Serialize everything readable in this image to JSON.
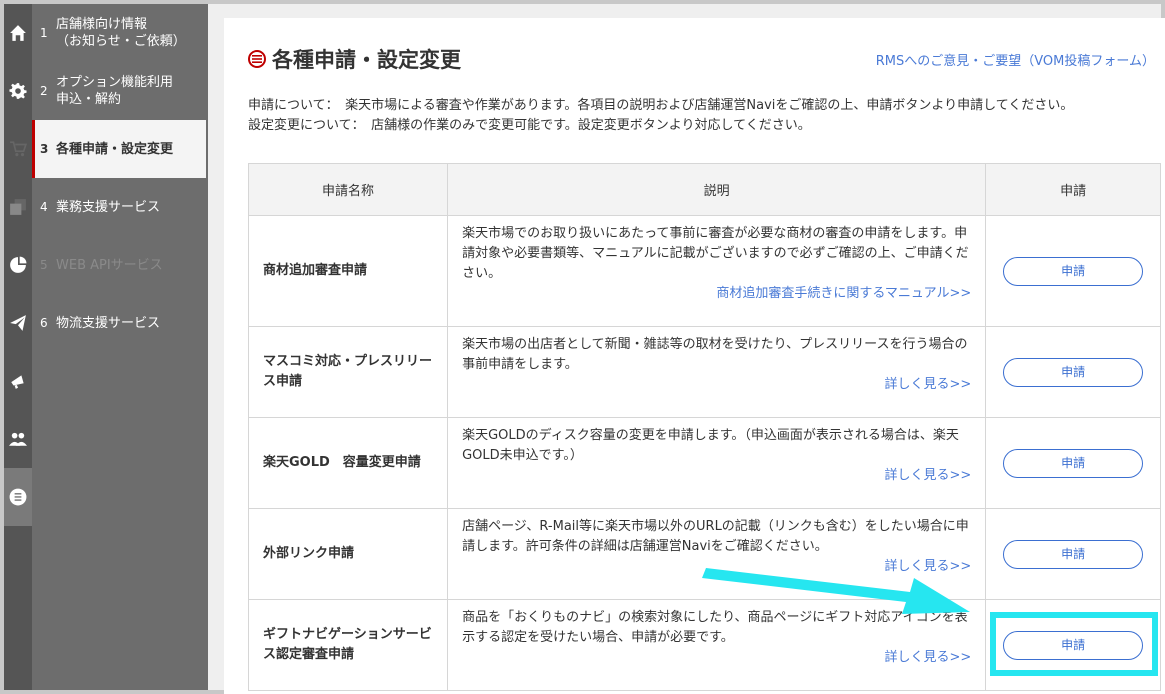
{
  "sidebar": {
    "menu": [
      {
        "num": "1",
        "label": "店舗様向け情報\n（お知らせ・ご依頼）"
      },
      {
        "num": "2",
        "label": "オプション機能利用\n申込・解約"
      },
      {
        "num": "3",
        "label": "各種申請・設定変更"
      },
      {
        "num": "4",
        "label": "業務支援サービス"
      },
      {
        "num": "5",
        "label": "WEB APIサービス"
      },
      {
        "num": "6",
        "label": "物流支援サービス"
      }
    ],
    "icons": [
      "home-icon",
      "gear-icon",
      "cart-icon",
      "copy-icon",
      "pie-chart-icon",
      "paper-plane-icon",
      "megaphone-icon",
      "users-icon",
      "list-icon"
    ]
  },
  "header": {
    "title": "各種申請・設定変更",
    "feedback_link": "RMSへのご意見・ご要望（VOM投稿フォーム）"
  },
  "intro": {
    "line1": "申請について：　楽天市場による審査や作業があります。各項目の説明および店舗運営Naviをご確認の上、申請ボタンより申請してください。",
    "line2": "設定変更について：　店舗様の作業のみで変更可能です。設定変更ボタンより対応してください。"
  },
  "table": {
    "headers": {
      "name": "申請名称",
      "description": "説明",
      "action": "申請"
    },
    "rows": [
      {
        "name": "商材追加審査申請",
        "description": "楽天市場でのお取り扱いにあたって事前に審査が必要な商材の審査の申請をします。申請対象や必要書類等、マニュアルに記載がございますので必ずご確認の上、ご申請ください。",
        "link": "商材追加審査手続きに関するマニュアル>>",
        "button": "申請"
      },
      {
        "name": "マスコミ対応・プレスリリース申請",
        "description": "楽天市場の出店者として新聞・雑誌等の取材を受けたり、プレスリリースを行う場合の事前申請をします。",
        "link": "詳しく見る>>",
        "button": "申請"
      },
      {
        "name": "楽天GOLD　容量変更申請",
        "description": "楽天GOLDのディスク容量の変更を申請します。（申込画面が表示される場合は、楽天GOLD未申込です。）",
        "link": "詳しく見る>>",
        "button": "申請"
      },
      {
        "name": "外部リンク申請",
        "description": "店舗ページ、R-Mail等に楽天市場以外のURLの記載（リンクも含む）をしたい場合に申請します。許可条件の詳細は店舗運営Naviをご確認ください。",
        "link": "詳しく見る>>",
        "button": "申請"
      },
      {
        "name": "ギフトナビゲーションサービス認定審査申請",
        "description": "商品を「おくりものナビ」の検索対象にしたり、商品ページにギフト対応アイコンを表示する認定を受けたい場合、申請が必要です。",
        "link": "詳しく見る>>",
        "button": "申請"
      }
    ]
  },
  "colors": {
    "accent": "#bf0000",
    "link": "#4a7ad6",
    "button": "#3b6fd1",
    "highlight": "#26e6f0"
  }
}
